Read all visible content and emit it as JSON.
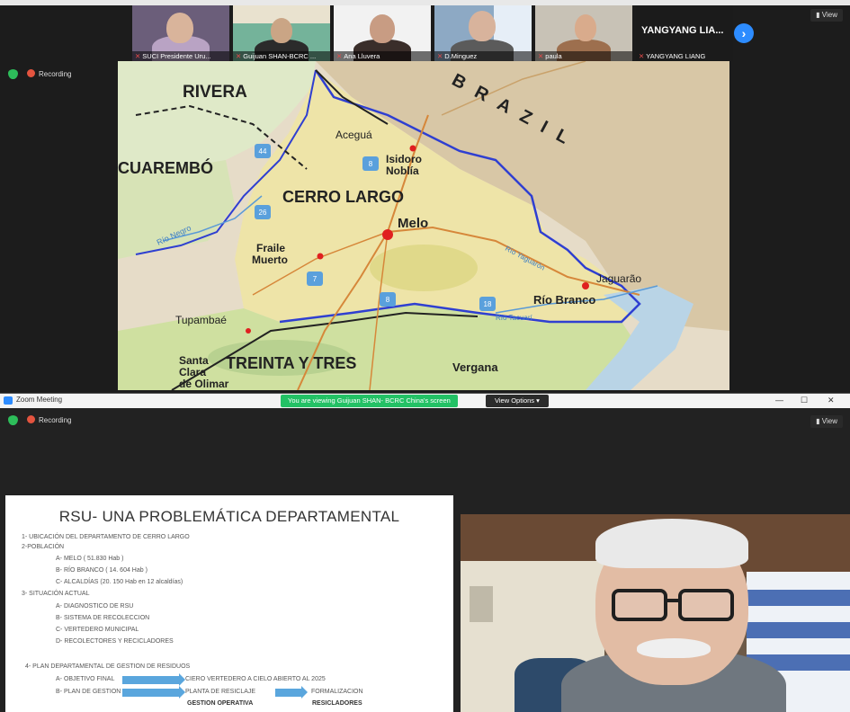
{
  "top_window": {
    "recording_label": "Recording",
    "view_label": "View",
    "participants": [
      {
        "name": "SUCI Presidente Uru..."
      },
      {
        "name": "Guijuan SHAN-BCRC ..."
      },
      {
        "name": "Ana Lluvera"
      },
      {
        "name": "D.Minguez"
      },
      {
        "name": "paula"
      },
      {
        "name": "YANGYANG LIANG",
        "display": "YANGYANG LIA..."
      }
    ]
  },
  "map": {
    "labels": {
      "brazil": "BRAZIL",
      "rivera": "RIVERA",
      "tacuarembo": "CUAREMBÓ",
      "cerro_largo": "CERRO LARGO",
      "acegua": "Aceguá",
      "isidoro_1": "Isidoro",
      "isidoro_2": "Noblía",
      "melo": "Melo",
      "fraile_1": "Fraile",
      "fraile_2": "Muerto",
      "jaguarao": "Jaguarão",
      "rio_branco": "Río Branco",
      "tupambae": "Tupambaé",
      "santa_1": "Santa",
      "santa_2": "Clara",
      "santa_3": "de Olimar",
      "treinta": "TREINTA Y TRES",
      "vergana": "Vergana",
      "rio_negro": "Río Negro",
      "rio_yaguaron": "Río Yaguarón",
      "rio_tacuari": "Río Tacuarí"
    },
    "route_numbers": [
      "44",
      "26",
      "8",
      "7",
      "8",
      "18"
    ]
  },
  "bottom_window": {
    "title": "Zoom Meeting",
    "share_banner": "You are viewing Guijuan SHAN- BCRC China's screen",
    "view_options": "View Options ▾",
    "recording_label": "Recording",
    "view_label": "View",
    "window_controls": [
      "—",
      "☐",
      "✕"
    ]
  },
  "slide": {
    "title": "RSU- UNA PROBLEMÁTICA DEPARTAMENTAL",
    "lines": [
      "1- UBICACIÓN DEL DEPARTAMENTO DE CERRO LARGO",
      "2-POBLACIÓN",
      "A- MELO ( 51.830 Hab )",
      "B- RÍO BRANCO ( 14. 604 Hab )",
      "C- ALCALDÍAS (20. 150 Hab en 12 alcaldías)",
      "3- SITUACIÓN ACTUAL",
      "A- DIAGNOSTICO DE RSU",
      "B- SISTEMA DE RECOLECCION",
      "C- VERTEDERO MUNICIPAL",
      "D- RECOLECTORES Y RECICLADORES",
      "4- PLAN DEPARTAMENTAL DE GESTION DE RESIDUOS",
      "A- OBJETIVO FINAL",
      "B- PLAN DE GESTION",
      "CIERO VERTEDERO A CIELO ABIERTO AL 2025",
      "PLANTA DE RESICLAJE",
      "FORMALIZACION",
      "GESTION OPERATIVA",
      "RESICLADORES"
    ]
  },
  "colors": {
    "zoom_blue": "#2d8cff",
    "recording_red": "#e4543f",
    "banner_green": "#23c165",
    "map_land": "#eee4a8",
    "border_blue": "#2f3fd1"
  }
}
